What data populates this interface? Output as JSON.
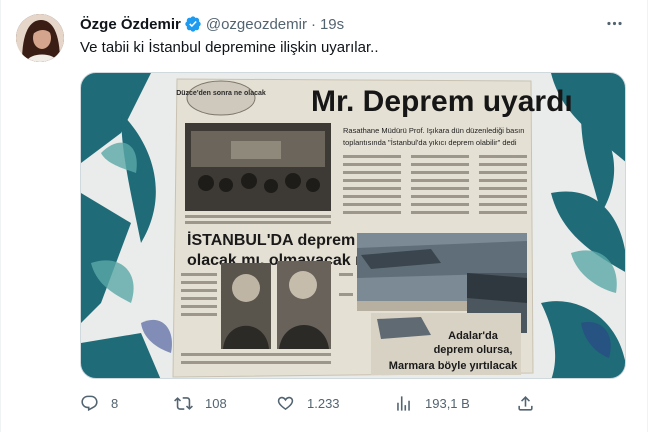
{
  "tweet": {
    "display_name": "Özge Özdemir",
    "handle": "@ozgeozdemir",
    "separator": "·",
    "time": "19s",
    "text": "Ve tabii ki İstanbul depremine ilişkin uyarılar.."
  },
  "media": {
    "headline_main": "Mr. Deprem uyardı",
    "badge": "Düzce'den sonra ne olacak",
    "subhead_1": "İSTANBUL'DA deprem",
    "subhead_2": "olacak mı, olmayacak mı?",
    "lead_line_1": "Rasathane Müdürü Prof. Işıkara dün düzenlediği basın",
    "lead_line_2": "toplantısında \"İstanbul'da yıkıcı deprem olabilir\" dedi",
    "sidebar_1": "Adalar'da",
    "sidebar_2": "deprem olursa,",
    "sidebar_3": "Marmara böyle yırtılacak"
  },
  "actions": {
    "replies": "8",
    "retweets": "108",
    "likes": "1.233",
    "views": "193,1 B"
  },
  "icons": [
    "verified-badge-icon",
    "more-icon",
    "reply-icon",
    "retweet-icon",
    "like-icon",
    "views-icon",
    "share-icon"
  ],
  "colors": {
    "verified": "#1d9bf0",
    "muted": "#536471",
    "text": "#0f1419"
  }
}
